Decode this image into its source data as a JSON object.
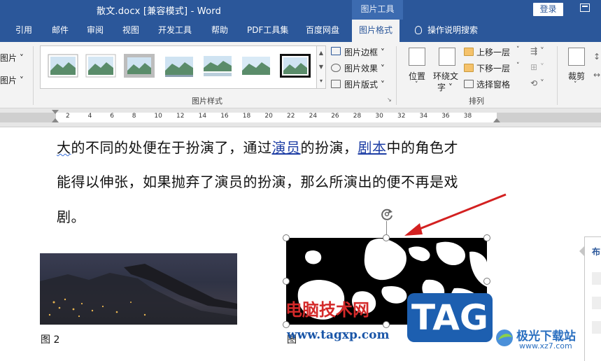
{
  "titlebar": {
    "doc_title": "散文.docx [兼容模式]  -  Word",
    "context_tab_title": "图片工具",
    "login_button": "登录"
  },
  "tabs": [
    {
      "label": "引用"
    },
    {
      "label": "邮件"
    },
    {
      "label": "审阅"
    },
    {
      "label": "视图"
    },
    {
      "label": "开发工具"
    },
    {
      "label": "帮助"
    },
    {
      "label": "PDF工具集"
    },
    {
      "label": "百度网盘"
    },
    {
      "label": "图片格式",
      "active": true
    },
    {
      "label": "操作说明搜索"
    }
  ],
  "ribbon": {
    "left_cut_1": "图片 ˅",
    "left_cut_2": "图片 ˅",
    "picture_styles_group": "图片样式",
    "picture_border": "图片边框 ˅",
    "picture_effects": "图片效果 ˅",
    "picture_layout": "图片版式 ˅",
    "position": "位置",
    "wrap_text_1": "环绕文",
    "wrap_text_2": "字 ˅",
    "bring_forward": "上移一层",
    "send_backward": "下移一层",
    "selection_pane": "选择窗格",
    "arrange_group": "排列",
    "crop": "裁剪",
    "crop_arrow": "˅"
  },
  "ruler": {
    "ticks": [
      "2",
      "4",
      "6",
      "8",
      "10",
      "12",
      "14",
      "16",
      "18",
      "20",
      "22",
      "24",
      "26",
      "28",
      "30",
      "32",
      "34",
      "36",
      "38"
    ]
  },
  "document": {
    "line1": {
      "part1": "大",
      "part2": "的不同的处便在于扮演了，通过",
      "link1": "演员",
      "part3": "的扮演，",
      "link2": "剧本",
      "part4": "中的角色才"
    },
    "line2": "能得以伸张，如果抛弃了演员的扮演，那么所演出的便不再是戏",
    "line3": "剧。",
    "caption1": "图 2",
    "caption2": "图"
  },
  "layout_pane": {
    "title": "布"
  },
  "watermarks": {
    "cn_text": "电脑技术网",
    "url": "www.tagxp.com",
    "tag": "TAG",
    "xz7_cn": "极光下载站",
    "xz7_url": "www.xz7.com"
  }
}
